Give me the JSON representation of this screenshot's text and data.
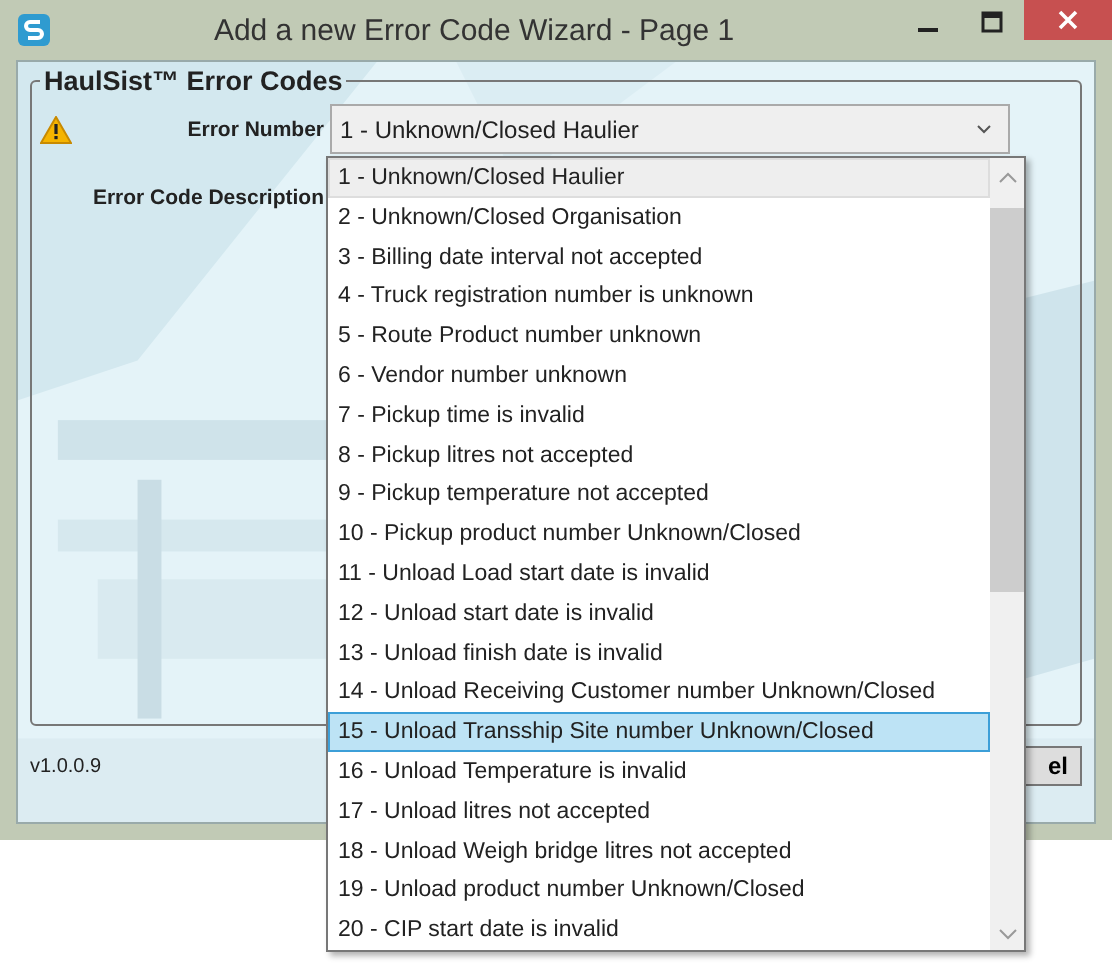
{
  "window": {
    "title": "Add a new Error Code Wizard - Page 1"
  },
  "group": {
    "title": "HaulSist™ Error Codes"
  },
  "fields": [
    {
      "label": "Error Number",
      "value": "1 - Unknown/Closed Haulier",
      "warning": true
    },
    {
      "label": "Error Code Description",
      "warning": false
    }
  ],
  "dropdown": {
    "items": [
      {
        "label": "1 - Unknown/Closed Haulier",
        "selected": false,
        "hovered": true
      },
      {
        "label": "2 - Unknown/Closed Organisation",
        "selected": false,
        "hovered": false
      },
      {
        "label": "3 - Billing date interval not accepted",
        "selected": false,
        "hovered": false
      },
      {
        "label": "4 - Truck registration number is unknown",
        "selected": false,
        "hovered": false
      },
      {
        "label": "5 - Route Product number unknown",
        "selected": false,
        "hovered": false
      },
      {
        "label": "6 - Vendor number unknown",
        "selected": false,
        "hovered": false
      },
      {
        "label": "7 - Pickup time is invalid",
        "selected": false,
        "hovered": false
      },
      {
        "label": "8 - Pickup litres not accepted",
        "selected": false,
        "hovered": false
      },
      {
        "label": "9 - Pickup temperature not accepted",
        "selected": false,
        "hovered": false
      },
      {
        "label": "10 - Pickup product number Unknown/Closed",
        "selected": false,
        "hovered": false
      },
      {
        "label": "11 - Unload Load start date is invalid",
        "selected": false,
        "hovered": false
      },
      {
        "label": "12 - Unload start date is invalid",
        "selected": false,
        "hovered": false
      },
      {
        "label": "13 - Unload finish date is invalid",
        "selected": false,
        "hovered": false
      },
      {
        "label": "14 - Unload Receiving Customer number Unknown/Closed",
        "selected": false,
        "hovered": false
      },
      {
        "label": "15 - Unload Transship Site number Unknown/Closed",
        "selected": true,
        "hovered": false
      },
      {
        "label": "16 - Unload Temperature is invalid",
        "selected": false,
        "hovered": false
      },
      {
        "label": "17 - Unload litres not accepted",
        "selected": false,
        "hovered": false
      },
      {
        "label": "18 - Unload Weigh bridge litres not accepted",
        "selected": false,
        "hovered": false
      },
      {
        "label": "19 - Unload product number Unknown/Closed",
        "selected": false,
        "hovered": false
      },
      {
        "label": "20 - CIP start date is invalid",
        "selected": false,
        "hovered": false
      }
    ]
  },
  "footer": {
    "version": "v1.0.0.9",
    "button": "el"
  }
}
